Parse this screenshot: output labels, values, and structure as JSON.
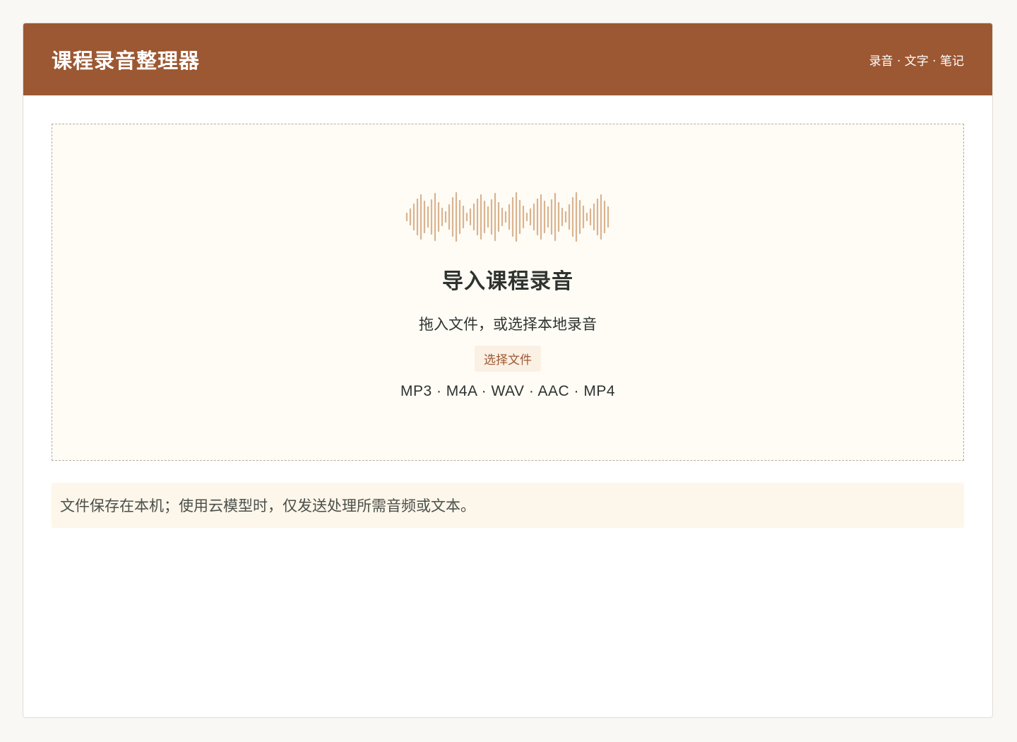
{
  "header": {
    "title": "课程录音整理器",
    "tagline": "录音 · 文字 · 笔记"
  },
  "dropzone": {
    "icon": "waveform-icon",
    "title": "导入课程录音",
    "subtitle": "拖入文件，或选择本地录音",
    "button_label": "选择文件",
    "formats": "MP3 · M4A · WAV · AAC · MP4"
  },
  "notice": {
    "text": "文件保存在本机；使用云模型时，仅发送处理所需音频或文本。"
  },
  "colors": {
    "header_bg": "#9c5832",
    "accent": "#9c5832",
    "waveform": "#d9b48f",
    "dropzone_bg": "#fffcf6",
    "notice_bg": "#fdf6ea",
    "text": "#2f332e"
  }
}
